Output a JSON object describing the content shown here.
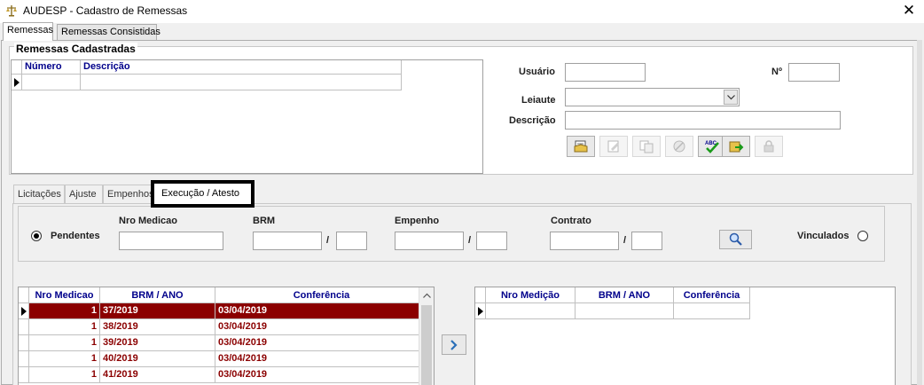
{
  "window": {
    "title": "AUDESP - Cadastro de Remessas",
    "close_glyph": "✕"
  },
  "main_tabs": [
    {
      "label": "Remessas"
    },
    {
      "label": "Remessas Consistidas"
    }
  ],
  "remessas_group": {
    "title": "Remessas Cadastradas",
    "columns": [
      "Número",
      "Descrição"
    ]
  },
  "form": {
    "usuario_label": "Usuário",
    "usuario_value": "",
    "numero_label": "Nº",
    "numero_value": "",
    "leiaute_label": "Leiaute",
    "leiaute_value": "",
    "descricao_label": "Descrição",
    "descricao_value": ""
  },
  "toolbar_icons": [
    "new-document-icon",
    "edit-document-icon",
    "copy-document-icon",
    "cancel-icon",
    "spell-check-icon",
    "export-document-icon",
    "lock-icon"
  ],
  "inner_tabs": [
    {
      "label": "Licitações"
    },
    {
      "label": "Ajuste"
    },
    {
      "label": "Empenhos"
    },
    {
      "label": "Execução / Atesto"
    }
  ],
  "filter": {
    "pendentes_label": "Pendentes",
    "nro_medicao_label": "Nro Medicao",
    "brm_label": "BRM",
    "empenho_label": "Empenho",
    "contrato_label": "Contrato",
    "vinculados_label": "Vinculados",
    "separator": "/"
  },
  "left_grid": {
    "columns": [
      "Nro Medicao",
      "BRM / ANO",
      "Conferência"
    ],
    "rows": [
      {
        "nro": "1",
        "brm": "37/2019",
        "conf": "03/04/2019"
      },
      {
        "nro": "1",
        "brm": "38/2019",
        "conf": "03/04/2019"
      },
      {
        "nro": "1",
        "brm": "39/2019",
        "conf": "03/04/2019"
      },
      {
        "nro": "1",
        "brm": "40/2019",
        "conf": "03/04/2019"
      },
      {
        "nro": "1",
        "brm": "41/2019",
        "conf": "03/04/2019"
      }
    ]
  },
  "right_grid": {
    "columns": [
      "Nro Medição",
      "BRM / ANO",
      "Conferência"
    ]
  },
  "colors": {
    "selected_row": "#8b0000",
    "row_text": "#8b0000",
    "header_text": "#00008b"
  }
}
